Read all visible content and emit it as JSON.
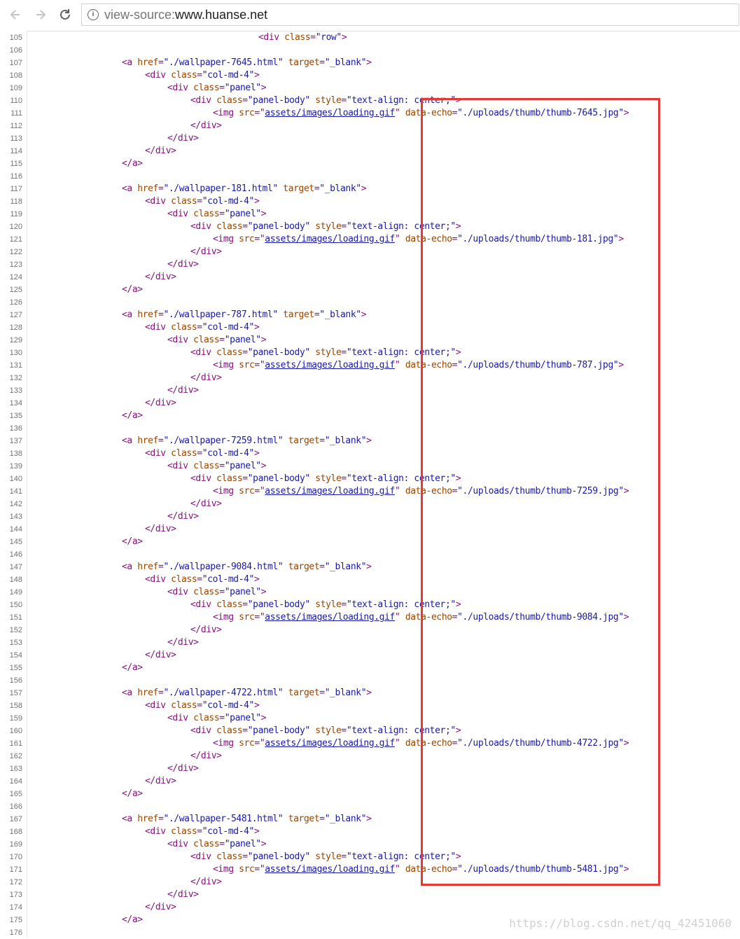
{
  "browser": {
    "back_icon": "arrow-left-icon",
    "forward_icon": "arrow-right-icon",
    "reload_icon": "reload-icon",
    "info_icon": "info-icon",
    "url_scheme": "view-source:",
    "url_host": "www.huanse.net"
  },
  "colors": {
    "tag": "#881280",
    "attribute": "#994500",
    "value": "#1a1aa6",
    "highlight_box": "#e53935"
  },
  "source": {
    "first_line_number": 105,
    "row_line": "<div class=\"row\">",
    "blocks": [
      {
        "href": "./wallpaper-7645.html",
        "echo": "./uploads/thumb/thumb-7645.jpg"
      },
      {
        "href": "./wallpaper-181.html",
        "echo": "./uploads/thumb/thumb-181.jpg"
      },
      {
        "href": "./wallpaper-787.html",
        "echo": "./uploads/thumb/thumb-787.jpg"
      },
      {
        "href": "./wallpaper-7259.html",
        "echo": "./uploads/thumb/thumb-7259.jpg"
      },
      {
        "href": "./wallpaper-9084.html",
        "echo": "./uploads/thumb/thumb-9084.jpg"
      },
      {
        "href": "./wallpaper-4722.html",
        "echo": "./uploads/thumb/thumb-4722.jpg"
      },
      {
        "href": "./wallpaper-5481.html",
        "echo": "./uploads/thumb/thumb-5481.jpg"
      }
    ],
    "target": "_blank",
    "col_class": "col-md-4",
    "panel_class": "panel",
    "panel_body_class": "panel-body",
    "panel_body_style": "text-align: center;",
    "img_src": "assets/images/loading.gif"
  },
  "watermark": "https://blog.csdn.net/qq_42451060"
}
